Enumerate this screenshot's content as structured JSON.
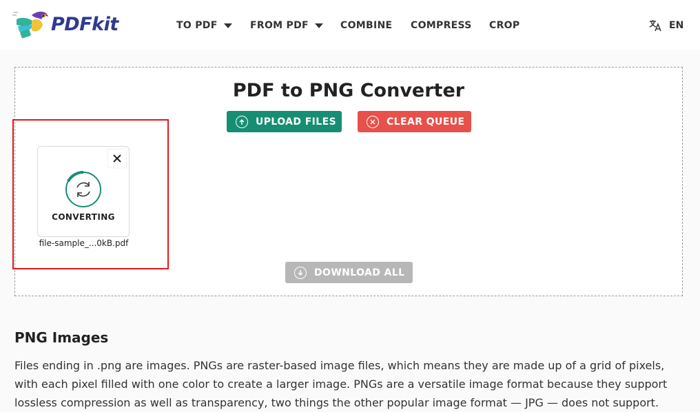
{
  "brand": {
    "name": "PDFkit"
  },
  "nav": {
    "items": [
      {
        "label": "TO PDF",
        "dropdown": true
      },
      {
        "label": "FROM PDF",
        "dropdown": true
      },
      {
        "label": "COMBINE",
        "dropdown": false
      },
      {
        "label": "COMPRESS",
        "dropdown": false
      },
      {
        "label": "CROP",
        "dropdown": false
      }
    ],
    "language": {
      "icon": "translate-icon",
      "label": "EN"
    }
  },
  "converter": {
    "title": "PDF to PNG Converter",
    "upload_label": "UPLOAD FILES",
    "clear_label": "CLEAR QUEUE",
    "download_label": "DOWNLOAD ALL",
    "files": [
      {
        "name": "file-sample_...0kB.pdf",
        "status": "CONVERTING"
      }
    ]
  },
  "content": {
    "heading": "PNG Images",
    "paragraph": "Files ending in .png are images. PNGs are raster-based image files, which means they are made up of a grid of pixels, with each pixel filled with one color to create a larger image. PNGs are a versatile image format because they support lossless compression as well as transparency, two things the other popular image format — JPG — does not support."
  },
  "colors": {
    "upload": "#168e73",
    "clear": "#e8504a",
    "download_disabled": "#b7b7b7",
    "highlight": "#e3161b",
    "brand": "#2f3a8f"
  }
}
